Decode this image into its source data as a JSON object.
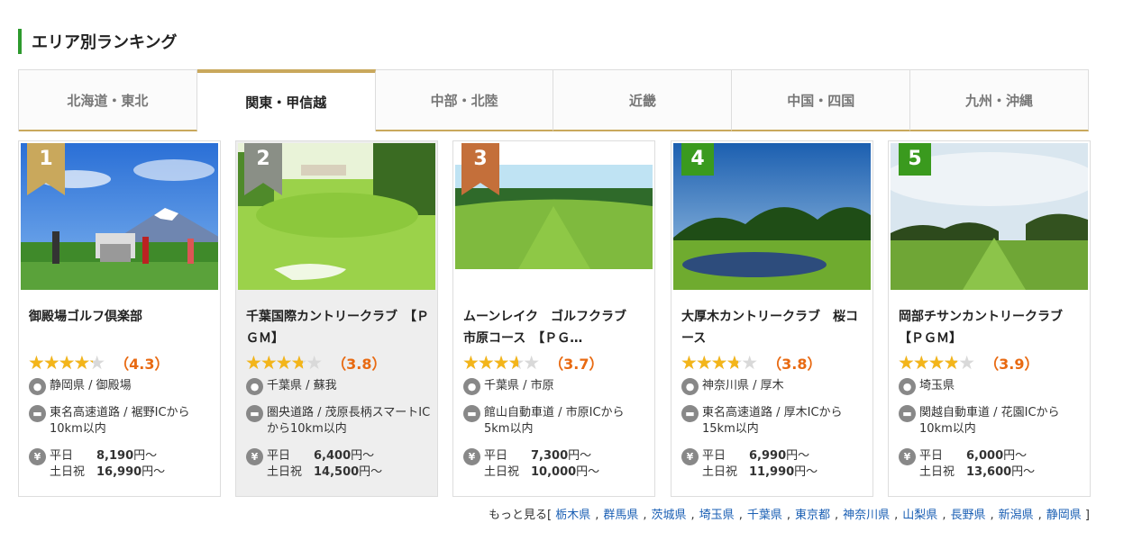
{
  "heading": "エリア別ランキング",
  "tabs": [
    "北海道・東北",
    "関東・甲信越",
    "中部・北陸",
    "近畿",
    "中国・四国",
    "九州・沖縄"
  ],
  "active_tab": 1,
  "colors": {
    "accent_green": "#2e9a2e",
    "gold": "#c9a85c",
    "silver": "#8a8f86",
    "bronze": "#c46f3a",
    "rank_green": "#3a9a1e",
    "star": "#f3b51a",
    "score": "#e86a12",
    "link": "#1a5fb4"
  },
  "courses": [
    {
      "rank": "1",
      "name": "御殿場ゴルフ倶楽部",
      "rating": 4.3,
      "rating_text": "（4.3）",
      "location": "静岡県 / 御殿場",
      "access": "東名高速道路 / 裾野ICから10km以内",
      "weekday_label": "平日",
      "weekday_price": "8,190",
      "holiday_label": "土日祝",
      "holiday_price": "16,990",
      "price_suffix": "円～",
      "rank_color": "#c9a85c",
      "highlight": false
    },
    {
      "rank": "2",
      "name": "千葉国際カントリークラブ　【ＰＧＭ】",
      "rating": 3.8,
      "rating_text": "（3.8）",
      "location": "千葉県 / 蘇我",
      "access": "圏央道路 / 茂原長柄スマートICから10km以内",
      "weekday_label": "平日",
      "weekday_price": "6,400",
      "holiday_label": "土日祝",
      "holiday_price": "14,500",
      "price_suffix": "円～",
      "rank_color": "#8a8f86",
      "highlight": true
    },
    {
      "rank": "3",
      "name": "ムーンレイク　ゴルフクラブ　市原コース　【ＰＧ…",
      "rating": 3.7,
      "rating_text": "（3.7）",
      "location": "千葉県 / 市原",
      "access": "館山自動車道 / 市原ICから5km以内",
      "weekday_label": "平日",
      "weekday_price": "7,300",
      "holiday_label": "土日祝",
      "holiday_price": "10,000",
      "price_suffix": "円～",
      "rank_color": "#c46f3a",
      "highlight": false
    },
    {
      "rank": "4",
      "name": "大厚木カントリークラブ　桜コース",
      "rating": 3.8,
      "rating_text": "（3.8）",
      "location": "神奈川県 / 厚木",
      "access": "東名高速道路 / 厚木ICから15km以内",
      "weekday_label": "平日",
      "weekday_price": "6,990",
      "holiday_label": "土日祝",
      "holiday_price": "11,990",
      "price_suffix": "円～",
      "rank_color": "#3a9a1e",
      "highlight": false
    },
    {
      "rank": "5",
      "name": "岡部チサンカントリークラブ　【ＰＧＭ】",
      "rating": 3.9,
      "rating_text": "（3.9）",
      "location": "埼玉県",
      "access": "関越自動車道 / 花園ICから10km以内",
      "weekday_label": "平日",
      "weekday_price": "6,000",
      "holiday_label": "土日祝",
      "holiday_price": "13,600",
      "price_suffix": "円～",
      "rank_color": "#3a9a1e",
      "highlight": false
    }
  ],
  "more": {
    "prefix": "もっと見る[",
    "suffix": "]",
    "separator": ",",
    "links": [
      "栃木県",
      "群馬県",
      "茨城県",
      "埼玉県",
      "千葉県",
      "東京都",
      "神奈川県",
      "山梨県",
      "長野県",
      "新潟県",
      "静岡県"
    ]
  }
}
